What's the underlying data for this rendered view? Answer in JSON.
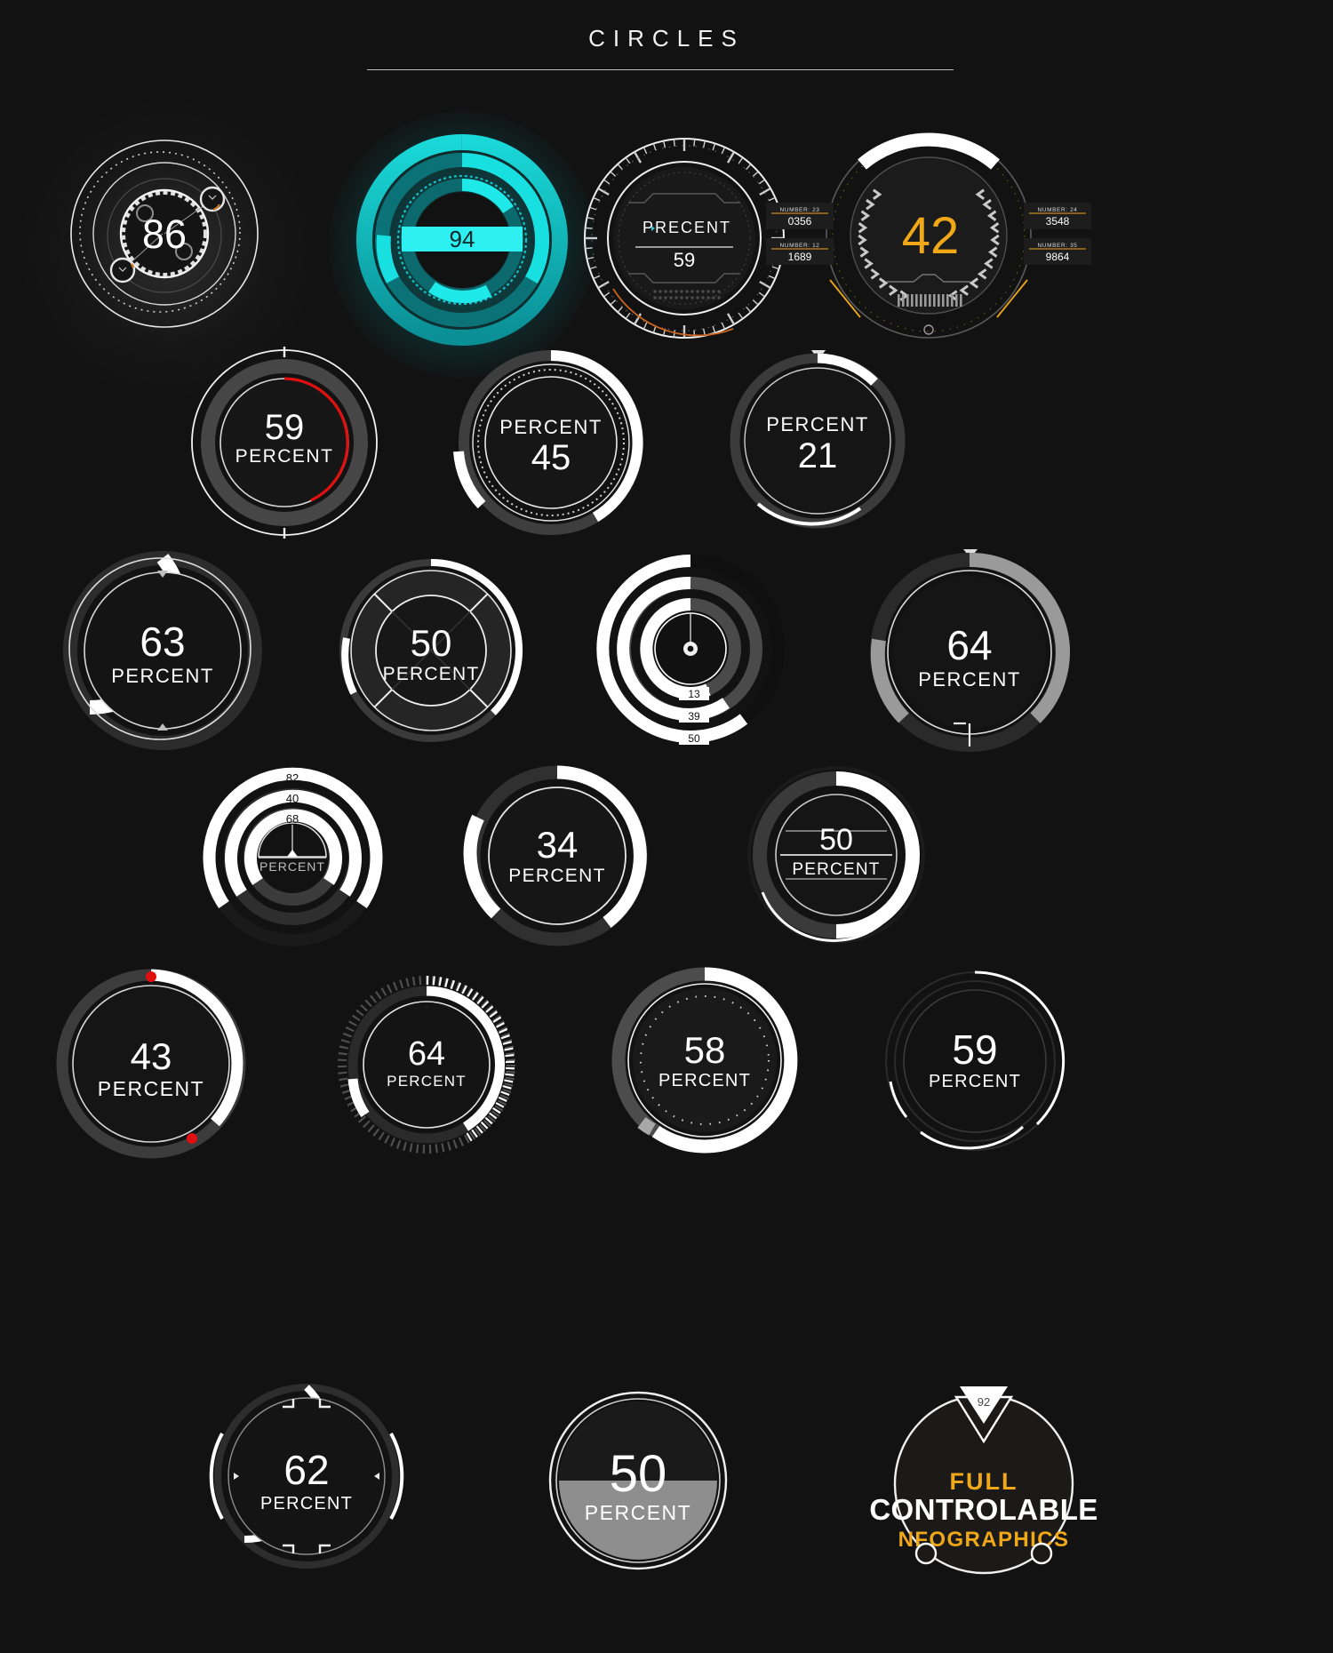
{
  "header": {
    "title": "CIRCLES"
  },
  "palette": {
    "background": "#121212",
    "white": "#ffffff",
    "light_gray": "#8c8c8c",
    "dark_gray": "#3a3a3a",
    "cyan": "#15d6d6",
    "cyan_dark": "#0f8f92",
    "red": "#e01010",
    "amber": "#f0a818",
    "orange": "#c8641e"
  },
  "chart_data": [
    {
      "type": "pie",
      "id": "gauge-86",
      "value": 86,
      "label": "",
      "unit": "",
      "accent": "#ffffff"
    },
    {
      "type": "pie",
      "id": "gauge-94",
      "value": 94,
      "label": "",
      "unit": "",
      "accent": "#15d6d6"
    },
    {
      "type": "pie",
      "id": "gauge-precent-59",
      "value": 59,
      "label": "PRECENT",
      "unit": "",
      "accent": "#ffffff"
    },
    {
      "type": "pie",
      "id": "gauge-42",
      "value": 42,
      "label": "",
      "unit": "",
      "accent": "#f0a818"
    },
    {
      "type": "pie",
      "id": "gauge-59-red",
      "value": 59,
      "label": "PERCENT",
      "accent": "#e01010"
    },
    {
      "type": "pie",
      "id": "gauge-45",
      "value": 45,
      "label": "PERCENT",
      "accent": "#ffffff"
    },
    {
      "type": "pie",
      "id": "gauge-21",
      "value": 21,
      "label": "PERCENT",
      "accent": "#ffffff"
    },
    {
      "type": "pie",
      "id": "gauge-63",
      "value": 63,
      "label": "PERCENT",
      "accent": "#ffffff"
    },
    {
      "type": "pie",
      "id": "gauge-50-quad",
      "value": 50,
      "label": "PERCENT",
      "accent": "#ffffff"
    },
    {
      "type": "pie",
      "id": "gauge-rings-13-39-50",
      "series": [
        {
          "name": "inner",
          "value": 13
        },
        {
          "name": "middle",
          "value": 39
        },
        {
          "name": "outer",
          "value": 50
        }
      ],
      "accent": "#ffffff"
    },
    {
      "type": "pie",
      "id": "gauge-64-gray",
      "value": 64,
      "label": "PERCENT",
      "accent": "#8c8c8c"
    },
    {
      "type": "pie",
      "id": "gauge-arcs-82-40-68",
      "series": [
        {
          "name": "outer",
          "value": 82
        },
        {
          "name": "middle",
          "value": 40
        },
        {
          "name": "inner",
          "value": 68
        }
      ],
      "label": "PERCENT",
      "accent": "#ffffff"
    },
    {
      "type": "pie",
      "id": "gauge-34",
      "value": 34,
      "label": "PERCENT",
      "accent": "#ffffff"
    },
    {
      "type": "pie",
      "id": "gauge-50-split",
      "value": 50,
      "label": "PERCENT",
      "accent": "#ffffff"
    },
    {
      "type": "pie",
      "id": "gauge-43",
      "value": 43,
      "label": "PERCENT",
      "accent": "#ffffff"
    },
    {
      "type": "pie",
      "id": "gauge-64-ticks",
      "value": 64,
      "label": "PERCENT",
      "accent": "#ffffff"
    },
    {
      "type": "pie",
      "id": "gauge-58",
      "value": 58,
      "label": "PERCENT",
      "accent": "#ffffff"
    },
    {
      "type": "pie",
      "id": "gauge-59-thin",
      "value": 59,
      "label": "PERCENT",
      "accent": "#ffffff"
    },
    {
      "type": "pie",
      "id": "gauge-62",
      "value": 62,
      "label": "PERCENT",
      "accent": "#ffffff"
    },
    {
      "type": "pie",
      "id": "gauge-50-half",
      "value": 50,
      "label": "PERCENT",
      "accent": "#8c8c8c"
    },
    {
      "type": "pie",
      "id": "badge-controlable",
      "value": 92,
      "accent": "#f0a818"
    }
  ],
  "gauges": {
    "g86": {
      "value": "86"
    },
    "g94": {
      "value": "94"
    },
    "g59precent": {
      "label": "PRECENT",
      "value": "59"
    },
    "g42": {
      "value": "42",
      "readouts": [
        {
          "name": "NUMBER: 23",
          "value": "0356"
        },
        {
          "name": "NUMBER: 12",
          "value": "1689"
        },
        {
          "name": "NUMBER: 24",
          "value": "3548"
        },
        {
          "name": "NUMBER: 35",
          "value": "9864"
        }
      ]
    },
    "g59red": {
      "value": "59",
      "label": "PERCENT"
    },
    "g45": {
      "label": "PERCENT",
      "value": "45"
    },
    "g21": {
      "label": "PERCENT",
      "value": "21"
    },
    "g63": {
      "value": "63",
      "label": "PERCENT"
    },
    "g50quad": {
      "value": "50",
      "label": "PERCENT"
    },
    "grings": {
      "t1": "13",
      "t2": "39",
      "t3": "50"
    },
    "g64gray": {
      "value": "64",
      "label": "PERCENT"
    },
    "garcs": {
      "t1": "82",
      "t2": "40",
      "t3": "68",
      "label": "PERCENT"
    },
    "g34": {
      "value": "34",
      "label": "PERCENT"
    },
    "g50split": {
      "value": "50",
      "label": "PERCENT"
    },
    "g43": {
      "value": "43",
      "label": "PERCENT"
    },
    "g64ticks": {
      "value": "64",
      "label": "PERCENT"
    },
    "g58": {
      "value": "58",
      "label": "PERCENT"
    },
    "g59thin": {
      "value": "59",
      "label": "PERCENT"
    },
    "g62": {
      "value": "62",
      "label": "PERCENT"
    },
    "g50half": {
      "value": "50",
      "label": "PERCENT"
    },
    "badge": {
      "tag": "92",
      "line1": "FULL",
      "line2": "CONTROLABLE",
      "line3": "NFOGRAPHICS"
    }
  }
}
